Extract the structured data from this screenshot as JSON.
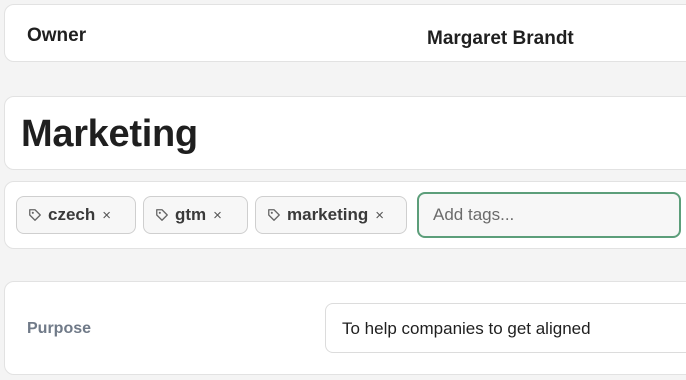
{
  "owner": {
    "label": "Owner",
    "value": "Margaret Brandt"
  },
  "page": {
    "title": "Marketing"
  },
  "tags": {
    "items": [
      {
        "label": "czech",
        "remove": "×"
      },
      {
        "label": "gtm",
        "remove": "×"
      },
      {
        "label": "marketing",
        "remove": "×"
      }
    ],
    "input_placeholder": "Add tags...",
    "input_value": "",
    "focus_color": "#5c9e7a"
  },
  "purpose": {
    "label": "Purpose",
    "value": "To help companies to get aligned"
  },
  "icons": {
    "tag": "tag-icon",
    "remove": "close-icon"
  }
}
